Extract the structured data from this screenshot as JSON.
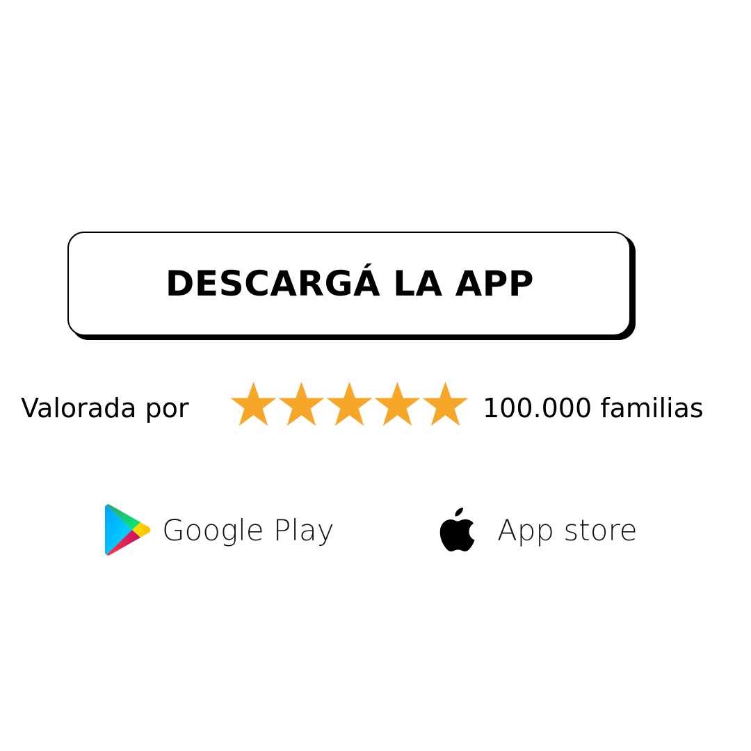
{
  "cta": {
    "label": "DESCARGÁ LA APP"
  },
  "rating": {
    "prefix": "Valorada por",
    "stars": 5,
    "max_stars": 5,
    "star_icon": "star-icon",
    "star_color": "#F6A72A",
    "suffix": "100.000 familias"
  },
  "stores": [
    {
      "icon": "google-play-icon",
      "label": "Google Play"
    },
    {
      "icon": "apple-icon",
      "label": "App store"
    }
  ],
  "colors": {
    "background": "#FFFFFF",
    "text": "#000000",
    "button_shadow": "#000000"
  }
}
